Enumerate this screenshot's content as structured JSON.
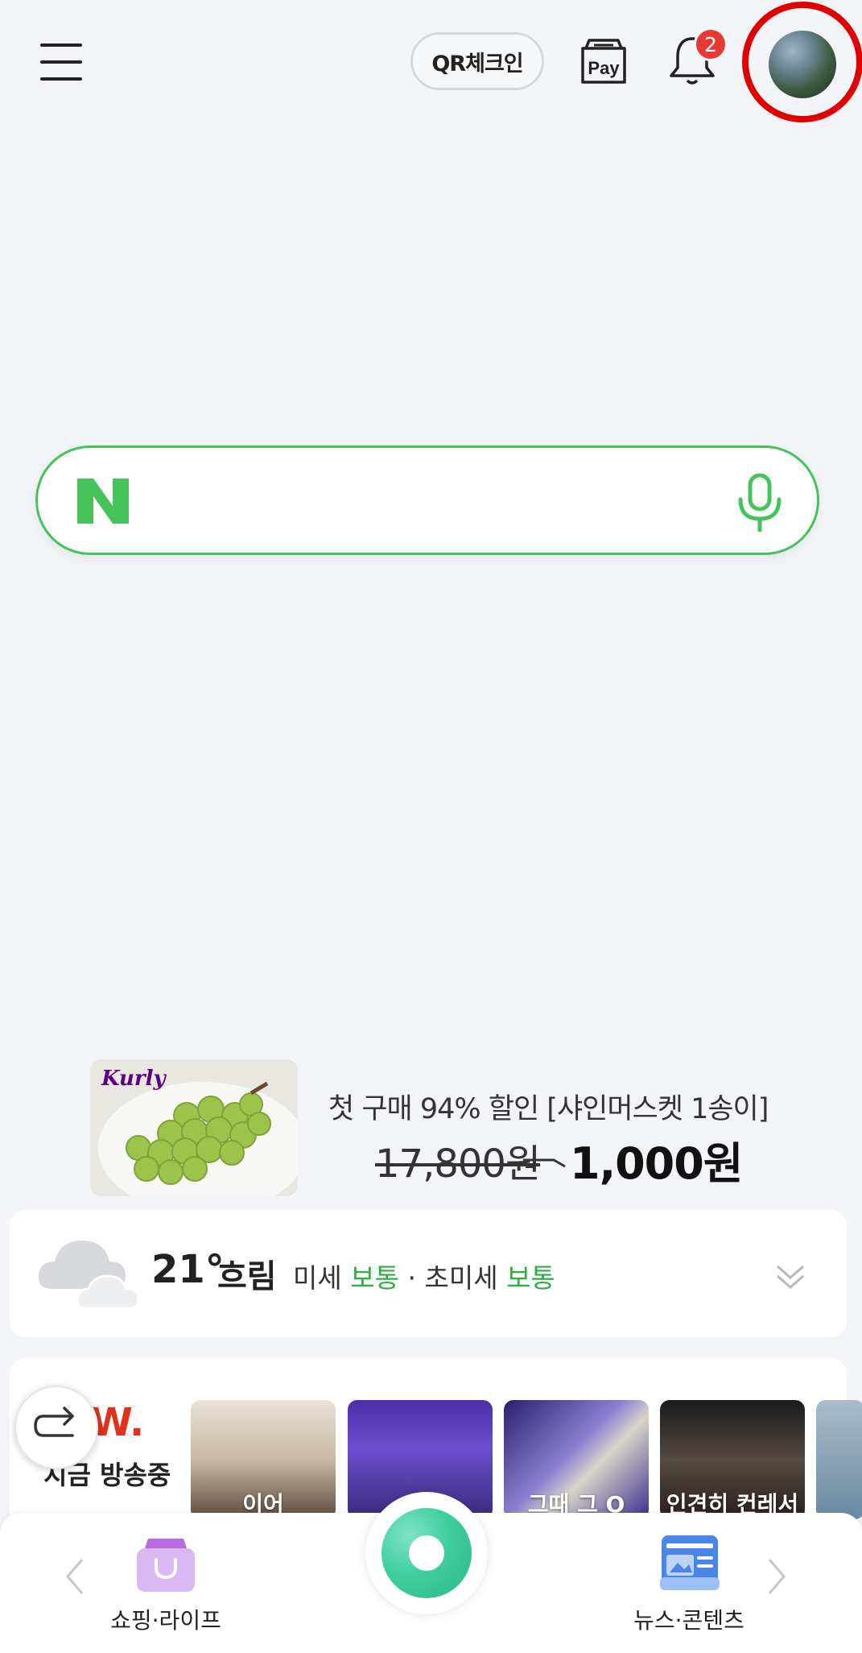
{
  "header": {
    "qr_checkin_label": "QR체크인",
    "pay_label": "Pay",
    "notification_count": "2"
  },
  "search": {
    "logo_letter": "N"
  },
  "ad": {
    "brand": "Kurly",
    "title": "첫 구매 94% 할인 [샤인머스켓 1송이]",
    "old_price": "17,800원",
    "new_price": "1,000원"
  },
  "weather": {
    "temperature": "21°",
    "condition": "흐림",
    "fine_dust_label": "미세",
    "fine_dust_value": "보통",
    "separator": "·",
    "ultrafine_dust_label": "초미세",
    "ultrafine_dust_value": "보통"
  },
  "now_broadcast": {
    "logo": "W.",
    "label": "지금 방송중",
    "thumbnails": [
      {
        "caption": "이어"
      },
      {
        "caption": ""
      },
      {
        "caption": "그때 그 O"
      },
      {
        "caption": "인견히 컨레서"
      },
      {
        "caption": ""
      }
    ]
  },
  "bottom_nav": {
    "shopping_label": "쇼핑·라이프",
    "news_label": "뉴스·콘텐츠"
  },
  "colors": {
    "naver_green": "#46c35a",
    "badge_red": "#e53935",
    "highlight_red": "#e00000",
    "dust_good_green": "#2fae44"
  }
}
